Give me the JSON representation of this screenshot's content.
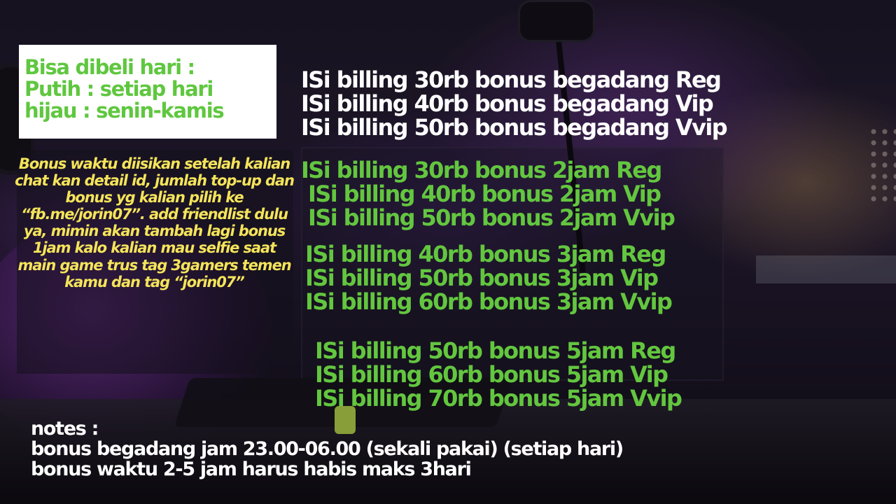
{
  "schedule": {
    "line1": "Bisa dibeli hari :",
    "line2": "Putih : setiap hari",
    "line3": "hijau : senin-kamis"
  },
  "bonus_info": "Bonus waktu diisikan setelah kalian chat kan detail id, jumlah top-up dan bonus yg kalian pilih ke “fb.me/jorin07”. add friendlist dulu ya, mimin akan tambah lagi bonus 1jam kalo kalian mau selfie saat main game trus tag 3gamers temen kamu dan tag “jorin07”",
  "packages": {
    "begadang": [
      "ISi billing 30rb bonus begadang Reg",
      "ISi billing 40rb bonus begadang Vip",
      "ISi billing 50rb bonus begadang Vvip"
    ],
    "two_hour": [
      "ISi billing 30rb bonus 2jam Reg",
      "ISi billing 40rb bonus 2jam Vip",
      "ISi billing 50rb bonus 2jam Vvip"
    ],
    "three_hour": [
      "ISi billing 40rb bonus 3jam Reg",
      "ISi billing 50rb bonus 3jam Vip",
      "ISi billing 60rb bonus 3jam Vvip"
    ],
    "five_hour": [
      "ISi billing 50rb bonus 5jam Reg",
      "ISi billing 60rb bonus 5jam Vip",
      "ISi billing 70rb bonus 5jam Vvip"
    ]
  },
  "notes": {
    "title": "notes :",
    "line1": "bonus begadang jam  23.00-06.00 (sekali pakai) (setiap hari)",
    "line2": "bonus waktu  2-5 jam harus habis maks 3hari"
  },
  "colors": {
    "white_text": "#ffffff",
    "green_text": "#63c63f",
    "yellow_text": "#f4e45a",
    "schedule_green": "#5fc73f"
  }
}
